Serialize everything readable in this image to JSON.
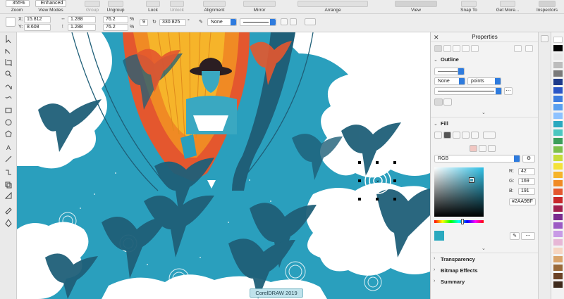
{
  "toolbar": {
    "zoom": {
      "value": "355%",
      "label": "Zoom"
    },
    "view_modes": {
      "value": "Enhanced",
      "label": "View Modes"
    },
    "group": "Group",
    "ungroup": "Ungroup",
    "lock": "Lock",
    "unlock": "Unlock",
    "alignment": "Alignment",
    "mirror": "Mirror",
    "arrange": "Arrange",
    "view": "View",
    "snap_to": "Snap To",
    "get_more": "Get More...",
    "inspectors": "Inspectors"
  },
  "property_bar": {
    "x_label": "X:",
    "x_value": "15.812",
    "y_label": "Y:",
    "y_value": "8.608",
    "width_value": "1.288",
    "height_value": "1.288",
    "scale_w": "76.2",
    "scale_h": "76.2",
    "scale_unit": "%",
    "objects_count": "9",
    "rotation_value": "330.825",
    "rotation_unit": "°",
    "outline_value": "None"
  },
  "canvas": {
    "caption": "CorelDRAW 2019"
  },
  "panel": {
    "title": "Properties",
    "outline_header": "Outline",
    "outline_width": "None",
    "outline_units": "points",
    "fill_header": "Fill",
    "color_model": "RGB",
    "r_label": "R:",
    "r_value": "42",
    "g_label": "G:",
    "g_value": "169",
    "b_label": "B:",
    "b_value": "191",
    "hex_value": "#2AA9BF",
    "transparency_header": "Transparency",
    "bitmap_effects_header": "Bitmap Effects",
    "summary_header": "Summary"
  },
  "colors": {
    "fill_color": "#2AA9BF",
    "accent": "#2e7bde",
    "sky_teal": "#2a9fbd",
    "bird_dark": "#1f5f78",
    "balloon_orange": "#f08a24",
    "balloon_yellow": "#f6b42a",
    "balloon_red": "#e4572e"
  },
  "palette": [
    "#ffffff",
    "#000000",
    "#e8e8e8",
    "#bdbdbd",
    "#7a7a7a",
    "#1d3a8a",
    "#2a56c6",
    "#3d7de0",
    "#5aa0f0",
    "#8dc2ff",
    "#2aa9bf",
    "#4cc7c0",
    "#3b9e5a",
    "#7cc04b",
    "#c7dc3a",
    "#f4e23a",
    "#f6b42a",
    "#f08a24",
    "#e4572e",
    "#c8282a",
    "#a1204d",
    "#7a2b8f",
    "#9c5bc4",
    "#c89be6",
    "#e7b7d6",
    "#f6d6c2",
    "#d9a46b",
    "#9a6a3a",
    "#6b4226",
    "#3e2a1c"
  ]
}
